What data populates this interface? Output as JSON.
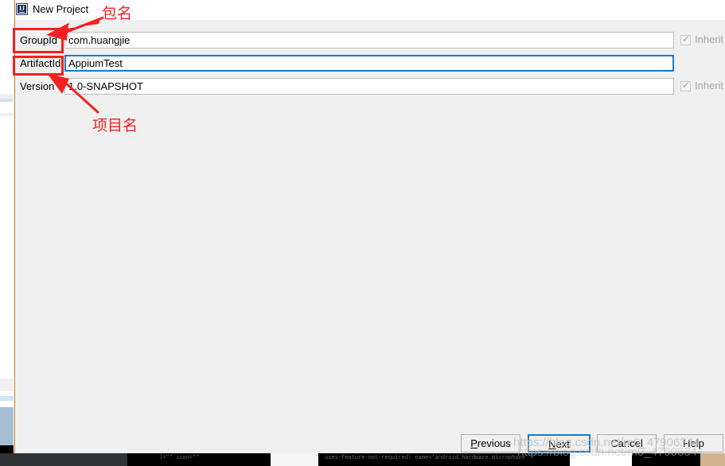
{
  "dialog": {
    "title": "New Project",
    "icon": "intellij-idea-icon"
  },
  "form": {
    "rows": [
      {
        "label": "GroupId",
        "value": "com.huangjie",
        "focused": false,
        "inherit_label": "Inherit",
        "inherit_checked": true,
        "inherit_enabled": false
      },
      {
        "label": "ArtifactId",
        "value": "AppiumTest",
        "focused": true,
        "inherit_label": "",
        "inherit_checked": false,
        "inherit_enabled": false
      },
      {
        "label": "Version",
        "value": "1.0-SNAPSHOT",
        "focused": false,
        "inherit_label": "Inherit",
        "inherit_checked": true,
        "inherit_enabled": false
      }
    ]
  },
  "buttons": {
    "previous": {
      "prefix": "",
      "mnemonic": "P",
      "suffix": "revious"
    },
    "next": {
      "prefix": "",
      "mnemonic": "N",
      "suffix": "ext"
    },
    "cancel": {
      "prefix": "",
      "mnemonic": "",
      "suffix": "Cancel"
    },
    "help": {
      "prefix": "",
      "mnemonic": "",
      "suffix": "Help"
    }
  },
  "annotations": {
    "package_name": "包名",
    "project_name": "项目名",
    "accent_color": "#f52020"
  },
  "watermark": {
    "text": "https://blog.csdn.net/m0_47906344"
  },
  "background": {
    "code_line_1": "l=\"\" icon=\"\"",
    "code_line_2": "uses-feature-not-required: name='android.hardware.microphone'"
  }
}
